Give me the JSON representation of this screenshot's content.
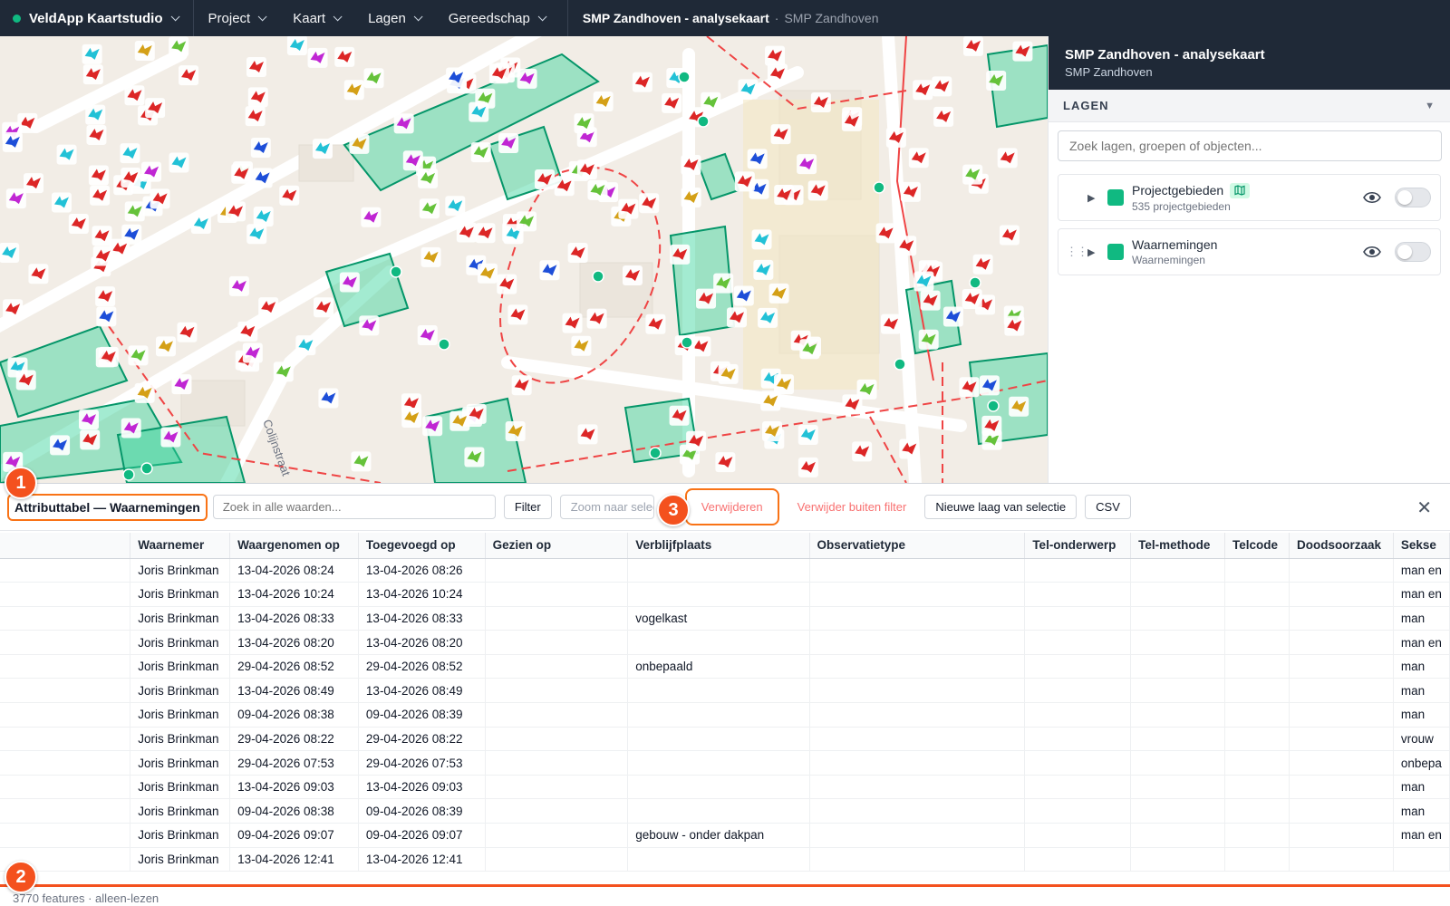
{
  "topbar": {
    "brand": "VeldApp Kaartstudio",
    "menus": [
      "Project",
      "Kaart",
      "Lagen",
      "Gereedschap"
    ],
    "title": "SMP Zandhoven - analysekaart",
    "separator": "·",
    "subtitle": "SMP Zandhoven"
  },
  "map": {
    "street_label": "Colijnstraat",
    "colors": {
      "area_fill": "#34d399",
      "area_stroke": "#059669",
      "boundary": "#ef4444",
      "pin": "#10b981"
    }
  },
  "panel": {
    "title": "SMP Zandhoven - analysekaart",
    "subtitle": "SMP Zandhoven",
    "layers_header": "LAGEN",
    "search_placeholder": "Zoek lagen, groepen of objecten...",
    "layers": [
      {
        "name": "Projectgebieden",
        "meta": "535 projectgebieden",
        "badge_icon": "map-icon",
        "visible_icon": "eye-icon",
        "toggle": false
      },
      {
        "name": "Waarnemingen",
        "meta": "Waarnemingen",
        "visible_icon": "eye-icon",
        "toggle": false
      }
    ]
  },
  "attr": {
    "title": "Attributtabel — Waarnemingen",
    "search_placeholder": "Zoek in alle waarden...",
    "buttons": {
      "filter": "Filter",
      "zoom": "Zoom naar selectie",
      "delete": "Verwijderen",
      "delete_outside": "Verwijder buiten filter",
      "new_layer": "Nieuwe laag van selectie",
      "csv": "CSV"
    },
    "markers": [
      "1",
      "2",
      "3"
    ],
    "columns": [
      "",
      "Waarnemer",
      "Waargenomen op",
      "Toegevoegd op",
      "Gezien op",
      "Verblijfplaats",
      "Observatietype",
      "Tel-onderwerp",
      "Tel-methode",
      "Telcode",
      "Doodsoorzaak",
      "Sekse"
    ],
    "rows": [
      [
        "",
        "Joris Brinkman",
        "13-04-2026 08:24",
        "13-04-2026 08:26",
        "",
        "",
        "",
        "",
        "",
        "",
        "",
        "man en"
      ],
      [
        "",
        "Joris Brinkman",
        "13-04-2026 10:24",
        "13-04-2026 10:24",
        "",
        "",
        "",
        "",
        "",
        "",
        "",
        "man en"
      ],
      [
        "",
        "Joris Brinkman",
        "13-04-2026 08:33",
        "13-04-2026 08:33",
        "",
        "vogelkast",
        "",
        "",
        "",
        "",
        "",
        "man"
      ],
      [
        "",
        "Joris Brinkman",
        "13-04-2026 08:20",
        "13-04-2026 08:20",
        "",
        "",
        "",
        "",
        "",
        "",
        "",
        "man en"
      ],
      [
        "",
        "Joris Brinkman",
        "29-04-2026 08:52",
        "29-04-2026 08:52",
        "",
        "onbepaald",
        "",
        "",
        "",
        "",
        "",
        "man"
      ],
      [
        "",
        "Joris Brinkman",
        "13-04-2026 08:49",
        "13-04-2026 08:49",
        "",
        "",
        "",
        "",
        "",
        "",
        "",
        "man"
      ],
      [
        "",
        "Joris Brinkman",
        "09-04-2026 08:38",
        "09-04-2026 08:39",
        "",
        "",
        "",
        "",
        "",
        "",
        "",
        "man"
      ],
      [
        "",
        "Joris Brinkman",
        "29-04-2026 08:22",
        "29-04-2026 08:22",
        "",
        "",
        "",
        "",
        "",
        "",
        "",
        "vrouw"
      ],
      [
        "",
        "Joris Brinkman",
        "29-04-2026 07:53",
        "29-04-2026 07:53",
        "",
        "",
        "",
        "",
        "",
        "",
        "",
        "onbepa"
      ],
      [
        "",
        "Joris Brinkman",
        "13-04-2026 09:03",
        "13-04-2026 09:03",
        "",
        "",
        "",
        "",
        "",
        "",
        "",
        "man"
      ],
      [
        "",
        "Joris Brinkman",
        "09-04-2026 08:38",
        "09-04-2026 08:39",
        "",
        "",
        "",
        "",
        "",
        "",
        "",
        "man"
      ],
      [
        "",
        "Joris Brinkman",
        "09-04-2026 09:07",
        "09-04-2026 09:07",
        "",
        "gebouw - onder dakpan",
        "",
        "",
        "",
        "",
        "",
        "man en"
      ],
      [
        "",
        "Joris Brinkman",
        "13-04-2026 12:41",
        "13-04-2026 12:41",
        "",
        "",
        "",
        "",
        "",
        "",
        "",
        ""
      ]
    ],
    "status": "3770 features · alleen-lezen"
  }
}
